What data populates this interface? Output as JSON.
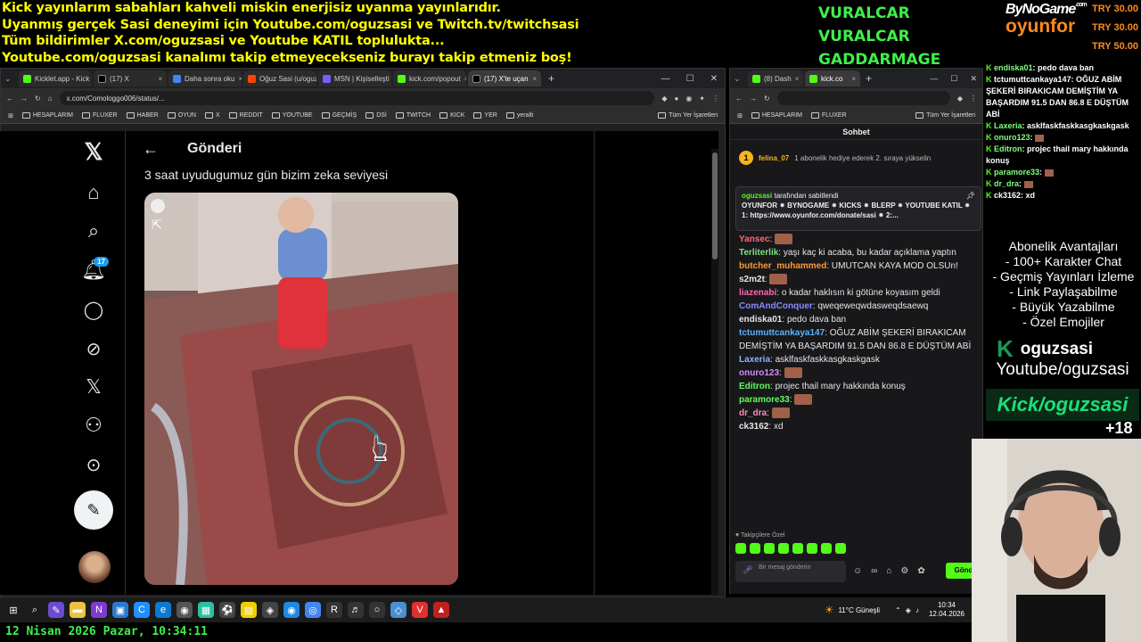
{
  "overlay": {
    "lines": [
      "Kick yayınlarım sabahları kahveli miskin enerjisiz uyanma yayınlarıdır.",
      "Uyanmış gerçek Sasi deneyimi için Youtube.com/oguzsasi ve Twitch.tv/twitchsasi",
      "Tüm bildirimler X.com/oguzsasi ve Youtube KATIL topluluktа...",
      "Youtube.com/oguzsasi kanalımı takip etmeyecekseniz burayı takip etmeniz boş!"
    ],
    "names": [
      "VURALCAR",
      "VURALCAR",
      "GADDARMAGE"
    ],
    "brand_top": "ByNoGame",
    "brand_small": ".com",
    "brand_bottom": "oyunfor",
    "donations": [
      "TRY 30.00",
      "TRY 30.00",
      "TRY 50.00"
    ]
  },
  "left_browser": {
    "tabs": [
      "Kicklet.app - Kick",
      "(17) X",
      "Daha sonra oku",
      "Oğuz Sasi (u/oguz",
      "MSN | Kişiselleşti",
      "kick.com/popout",
      "(17) X'te uçan"
    ],
    "url": "x.com/Comologgo006/status/...",
    "bookmarks": [
      "HESAPLARIM",
      "FLUXER",
      "HABER",
      "OYUN",
      "X",
      "REDDIT",
      "YOUTUBE",
      "GEÇMİŞ",
      "DSİ",
      "TWITCH",
      "KICK",
      "YER",
      "yeralti"
    ],
    "bookmarks_all": "Tüm Yer İşaretleri"
  },
  "x_page": {
    "back": "←",
    "title": "Gönderi",
    "text": "3 saat uyudugumuz gün bizim zeka seviyesi",
    "notif_count": "17"
  },
  "kick_browser": {
    "tabs": [
      "(8) Dash",
      "kick.co"
    ],
    "bookmarks": [
      "HESAPLARIM",
      "FLUXER"
    ],
    "bookmarks_all": "Tüm Yer İşaretleri",
    "chat_title": "Sohbet",
    "gift_user": "felina_07",
    "gift_text": "1 abonelik hediye ederek 2. sıraya yükselin",
    "gift_count": "1",
    "pinned_by": "oguzsasi",
    "pinned_label": "tarafından sabitlendi",
    "pinned_text": "OYUNFOR ⁕ BYNOGAME ⁕ KICKS ⁕ BLERP ⁕ YOUTUBE KATIL ⁕ 1: https://www.oyunfor.com/donate/sasi ⁕ 2:...",
    "messages": [
      {
        "user": "Yansec",
        "color": "#ff6b6b",
        "text": ""
      },
      {
        "user": "Terliterlik",
        "color": "#7fe07f",
        "text": "yaşı kaç ki acaba, bu kadar açıklama yaptın"
      },
      {
        "user": "butcher_muhammed",
        "color": "#ff9933",
        "text": "UMUTCAN KAYA MOD OLSUn!"
      },
      {
        "user": "s2m2t",
        "color": "#e6e6e6",
        "text": ""
      },
      {
        "user": "liazenabi",
        "color": "#ff66aa",
        "text": "o kadar haklısın ki götüne koyasım geldi"
      },
      {
        "user": "ComAndConquer",
        "color": "#8a8aff",
        "text": "qweqeweqwdasweqdsaewq"
      },
      {
        "user": "endiska01",
        "color": "#e6e6e6",
        "text": "pedo dava ban"
      },
      {
        "user": "tctumuttcankaya147",
        "color": "#5ab4ff",
        "text": "OĞUZ ABİM ŞEKERİ BIRAKICAM DEMİŞTİM YA BAŞARDIM 91.5 DAN 86.8 E DÜŞTÜM ABİ"
      },
      {
        "user": "Laxeria",
        "color": "#8ab4ff",
        "text": "asklfaskfaskkasgkaskgask"
      },
      {
        "user": "onuro123",
        "color": "#d68aff",
        "text": ""
      },
      {
        "user": "Editron",
        "color": "#5cff5c",
        "text": "projec thail mary hakkında konuş"
      },
      {
        "user": "paramore33",
        "color": "#5cff5c",
        "text": ""
      },
      {
        "user": "dr_dra",
        "color": "#ff8ab4",
        "text": ""
      },
      {
        "user": "ck3162",
        "color": "#e6e6e6",
        "text": "xd"
      }
    ],
    "followers_label": "Takipçilere Özel",
    "input_placeholder": "Bir mesaj gönderin",
    "send": "Gönd"
  },
  "side_chat": [
    {
      "user": "endiska01",
      "text": "pedo dava ban",
      "color": "#7fff7f"
    },
    {
      "user": "tctumuttcankaya147",
      "text": "OĞUZ ABİM ŞEKERİ BIRAKICAM DEMİŞTİM YA BAŞARDIM 91.5 DAN 86.8 E DÜŞTÜM ABİ",
      "color": "#ffffff"
    },
    {
      "user": "Laxeria",
      "text": "asklfaskfaskkasgkaskgask",
      "color": "#7fff7f"
    },
    {
      "user": "onuro123",
      "text": "",
      "color": "#7fff7f"
    },
    {
      "user": "Editron",
      "text": "projec thail mary hakkında konuş",
      "color": "#7fff7f"
    },
    {
      "user": "paramore33",
      "text": "",
      "color": "#7fff7f"
    },
    {
      "user": "dr_dra",
      "text": "",
      "color": "#7fff7f"
    },
    {
      "user": "ck3162",
      "text": "xd",
      "color": "#ffffff"
    }
  ],
  "abonelik": {
    "title": "Abonelik Avantajları",
    "items": [
      "- 100+ Karakter Chat",
      "- Geçmiş Yayınları İzleme",
      "- Link Paylaşabilme",
      "- Büyük Yazabilme",
      "- Özel Emojiler"
    ]
  },
  "socials": {
    "handle": "oguzsasi",
    "youtube": "Youtube/oguzsasi",
    "kick": "Kick/oguzsasi",
    "age": "+18"
  },
  "taskbar": {
    "weather": "11°C  Güneşli",
    "time": "10:34",
    "date": "12.04.2026"
  },
  "datetime": "12 Nisan 2026 Pazar, 10:34:11"
}
